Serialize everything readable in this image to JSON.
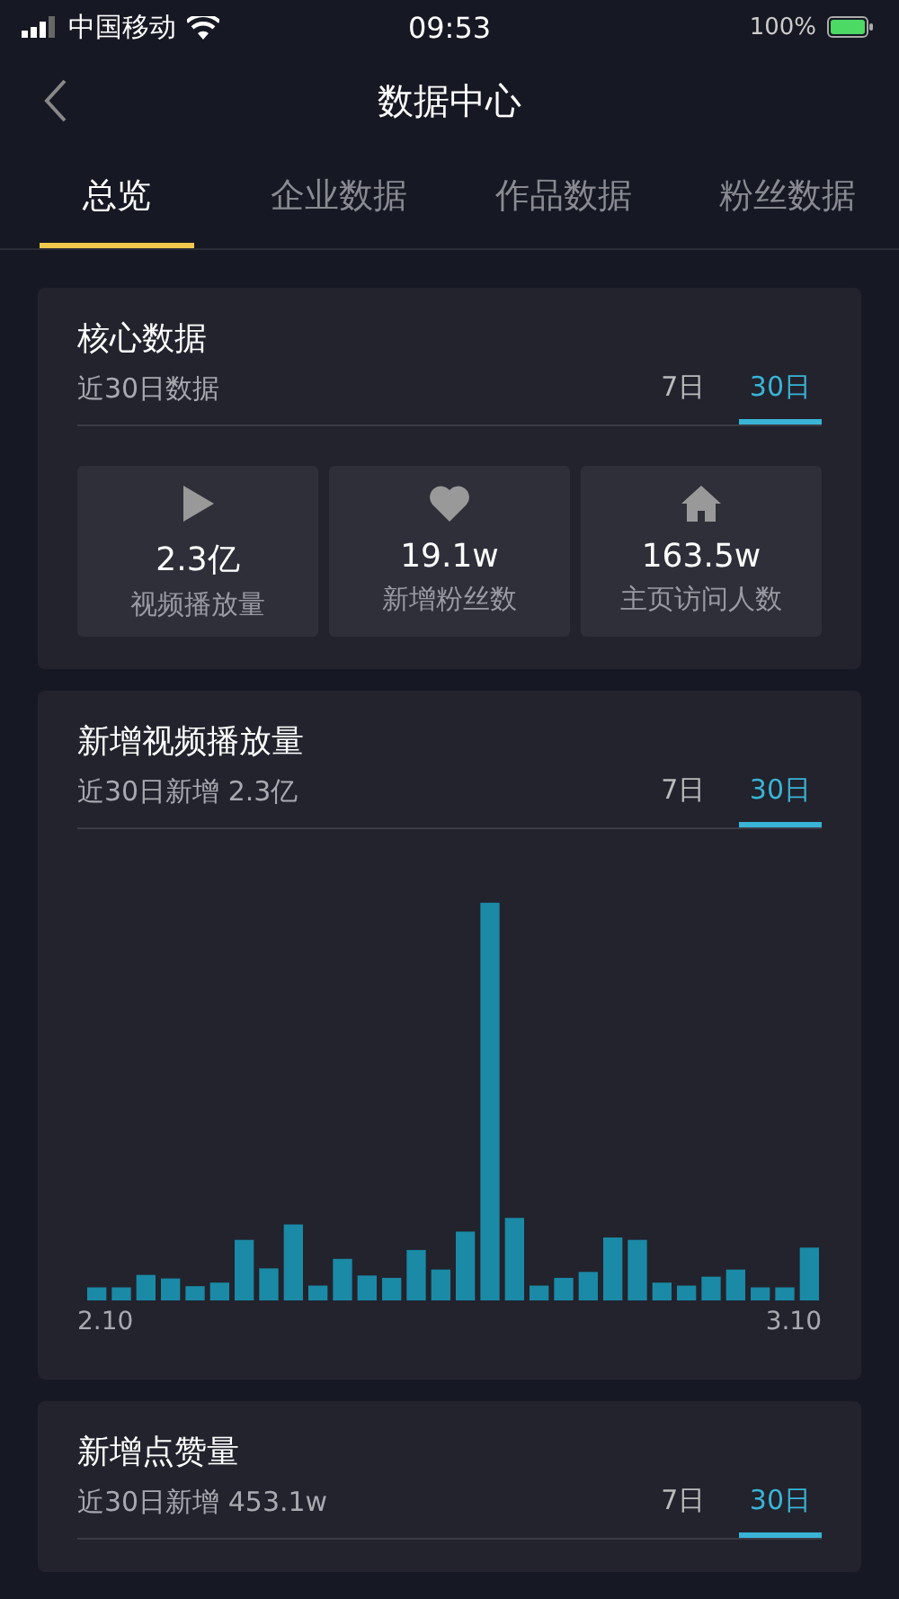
{
  "status_bar": {
    "carrier": "中国移动",
    "time": "09:53",
    "battery": "100%"
  },
  "nav": {
    "title": "数据中心"
  },
  "tabs": [
    {
      "label": "总览",
      "selected": true
    },
    {
      "label": "企业数据",
      "selected": false
    },
    {
      "label": "作品数据",
      "selected": false
    },
    {
      "label": "粉丝数据",
      "selected": false
    }
  ],
  "sections": [
    {
      "kind": "stats",
      "title": "核心数据",
      "subtitle": "近30日数据",
      "periods": [
        {
          "label": "7日",
          "selected": false
        },
        {
          "label": "30日",
          "selected": true
        }
      ],
      "stats": [
        {
          "value": "2.3亿",
          "label": "视频播放量"
        },
        {
          "value": "19.1w",
          "label": "新增粉丝数"
        },
        {
          "value": "163.5w",
          "label": "主页访问人数"
        }
      ]
    },
    {
      "kind": "chart",
      "title": "新增视频播放量",
      "subtitle": "近30日新增 2.3亿",
      "periods": [
        {
          "label": "7日",
          "selected": false
        },
        {
          "label": "30日",
          "selected": true
        }
      ],
      "x_start": "2.10",
      "x_end": "3.10"
    },
    {
      "kind": "plain",
      "title": "新增点赞量",
      "subtitle": "近30日新增 453.1w",
      "periods": [
        {
          "label": "7日",
          "selected": false
        },
        {
          "label": "30日",
          "selected": true
        }
      ]
    }
  ]
}
